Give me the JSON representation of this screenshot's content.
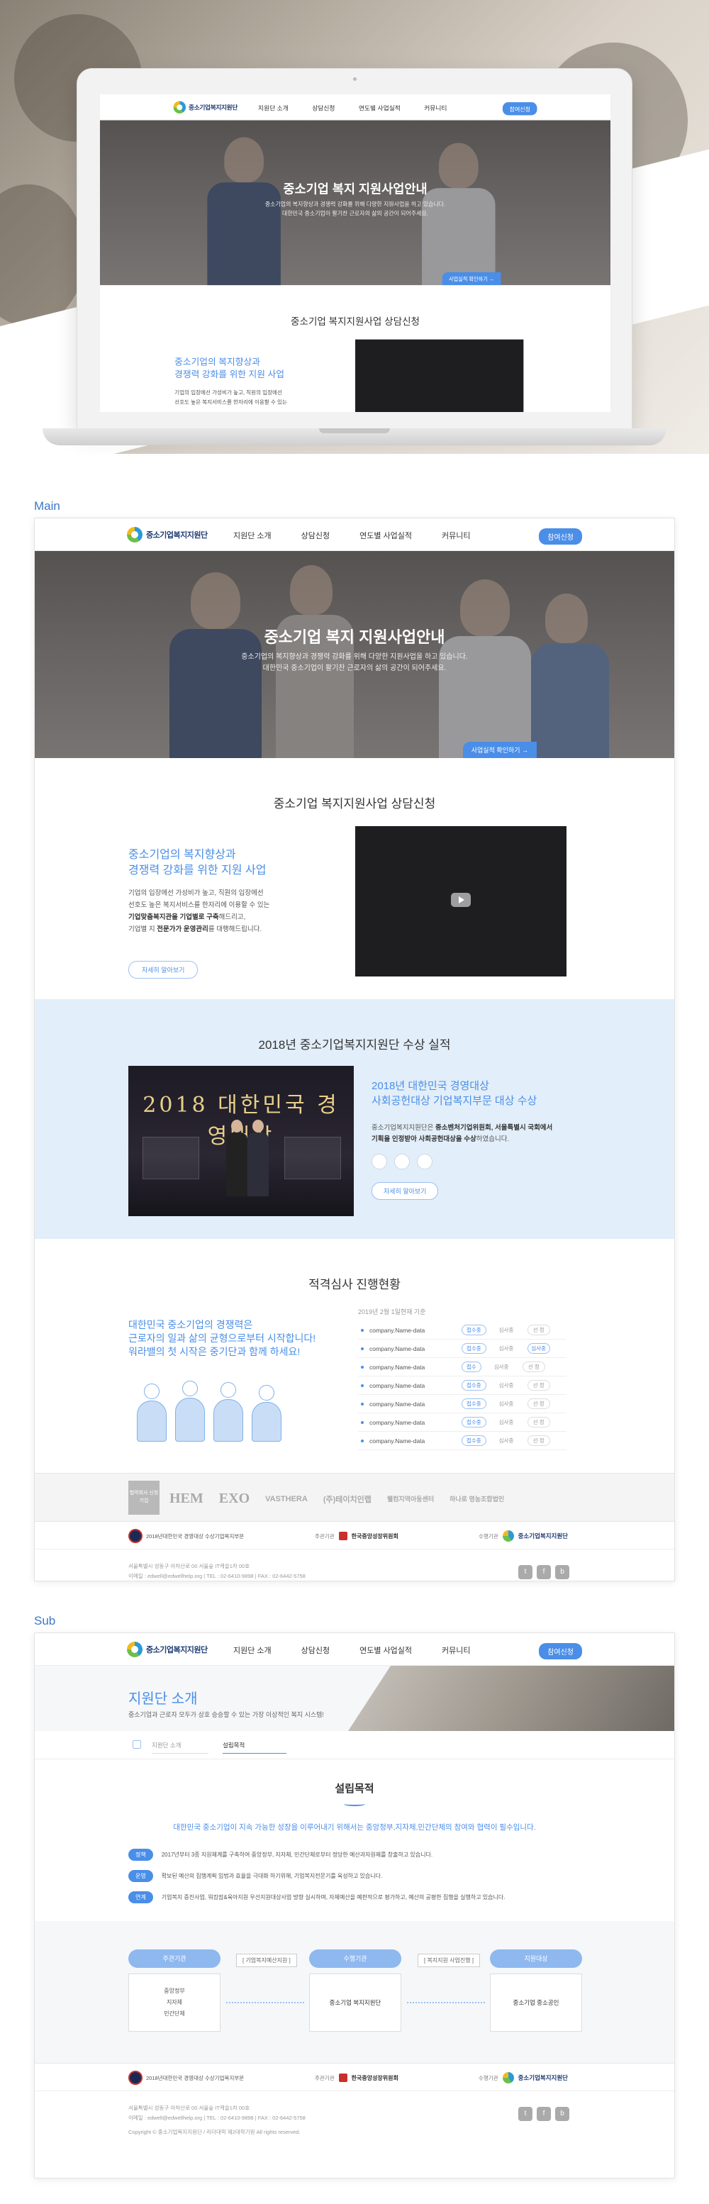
{
  "site": {
    "logo_text": "중소기업복지지원단",
    "nav": [
      "지원단 소개",
      "상담신청",
      "연도별 사업실적",
      "커뮤니티"
    ],
    "login_label": "참여신청"
  },
  "sections": {
    "main_label": "Main",
    "sub_label": "Sub"
  },
  "hero": {
    "title": "중소기업 복지 지원사업안내",
    "desc_line1": "중소기업의 복지향상과 경쟁력 강화를 위해 다양한 지원사업을 하고 있습니다.",
    "desc_line2": "대한민국 중소기업이 활기찬 근로자의 삶의 공간이 되어주세요.",
    "more_label": "사업실적 확인하기 →"
  },
  "consult": {
    "title": "중소기업 복지지원사업 상담신청",
    "sub_line1": "중소기업의 복지향상과",
    "sub_line2": "경쟁력 강화를 위한 지원 사업",
    "text_line1": "기업의 입장에선 가성비가 높고, 직원의 입장에선",
    "text_line2": "선호도 높은 복지서비스를 한자리에 이용할 수 있는",
    "text_bold3": "기업맞춤복지관을 기업별로 구축",
    "text_line3_rest": "해드리고,",
    "text_line4_pre": "기업별 지 ",
    "text_bold4": "전문가가 운영관리",
    "text_line4_rest": "를 대행해드립니다.",
    "more_label": "자세히 알아보기"
  },
  "award": {
    "title": "2018년 중소기업복지지원단 수상 실적",
    "banner_text": "2018 대한민국 경영대상",
    "sub_line1": "2018년 대한민국 경영대상",
    "sub_line2": "사회공헌대상 기업복지부문 대상 수상",
    "text_line1_pre": "중소기업복지지원단은 ",
    "text_bold1": "중소벤처기업위원회, 서울특별시 국회에서",
    "text_bold2": "기획을 인정받아 사회공헌대상을 수상",
    "text_line2_rest": "하였습니다.",
    "more_label": "자세히 알아보기"
  },
  "review": {
    "title": "적격심사 진행현황",
    "slogan_line1": "대한민국 중소기업의 경쟁력은",
    "slogan_line2": "근로자의 일과 삶의 균형으로부터 시작합니다!",
    "slogan_line3": "워라밸의 첫 시작은 중기단과 함께 하세요!",
    "date": "2019년 2월 1일현재 기준",
    "rows": [
      {
        "name": "company.Name-data",
        "tag": "접수중",
        "s1": "심사중",
        "s2": "선 정",
        "on": false
      },
      {
        "name": "company.Name-data",
        "tag": "접수중",
        "s1": "심사중",
        "s2": "심사중",
        "on": true
      },
      {
        "name": "company.Name-data",
        "tag": "접수",
        "s1": "심사중",
        "s2": "선 정",
        "on": false
      },
      {
        "name": "company.Name-data",
        "tag": "접수중",
        "s1": "심사중",
        "s2": "선 정",
        "on": false
      },
      {
        "name": "company.Name-data",
        "tag": "접수중",
        "s1": "심사중",
        "s2": "선 정",
        "on": false
      },
      {
        "name": "company.Name-data",
        "tag": "접수중",
        "s1": "심사중",
        "s2": "선 정",
        "on": false
      },
      {
        "name": "company.Name-data",
        "tag": "접수중",
        "s1": "심사중",
        "s2": "선 정",
        "on": false
      }
    ]
  },
  "partners": {
    "first": "협약회사 신청기업",
    "items": [
      "HEM",
      "EXO",
      "VASTHERA",
      "(주)테이치인랩",
      "웰컴지역아동센터",
      "하나로 영농조합법인"
    ]
  },
  "footer": {
    "emblem_text": "2018년대한민국 경영대상 수상기업복지부문",
    "host_label": "주관기관",
    "host_name": "한국중앙성장위원회",
    "run_label": "수행기관",
    "run_name": "중소기업복지지원단",
    "info_line1": "서울특별시 성동구 아차산로 00 서울숲 IT캐슬1차 00호",
    "info_line2": "이메일 : edwell@edwellhelp.org  |  TEL : 02-6410-9898  |  FAX : 02-6442-5758",
    "info_line3": "Copyright © 중소기업복지지원단 / 리더대학 제2대학기원 All rights reserved.",
    "sns": [
      "t",
      "f",
      "b"
    ]
  },
  "sub": {
    "title": "지원단 소개",
    "desc": "중소기업과 근로자 모두가 상호 승승할 수 있는 가장 이상적인 복지 시스템!",
    "crumb1": "지원단 소개",
    "crumb2": "설립목적",
    "purpose_title": "설립목적",
    "purpose_lead": "대한민국 중소기업이 지속 가능한 성장을 이루어내기 위해서는 중앙정부,지자체,민간단체의 참여와 협력이 필수입니다.",
    "purpose_rows": [
      {
        "pill": "정책",
        "text": "2017년부터 3종 지원체계를 구축하여 중앙정부, 지자체, 민간단체로부터 정당한 예산과자원제를 창출하고 있습니다."
      },
      {
        "pill": "운영",
        "text": "확보된 예산의 집행계획 입법과 효율을 극대화 하기위해, 기업복지전문기를 육성하고 있습니다."
      },
      {
        "pill": "연계",
        "text": "기업복지 증진사업, 워킹맘&육아지원 우선지원대상사업 방향 실시하며, 자체예산을 예판적으로 평가하고, 예산의 공평한 집행을 실행하고 있습니다."
      }
    ],
    "flow": {
      "head1": "주관기관",
      "mid1": "[ 기업복지예산지원 ]",
      "head2": "수행기관",
      "mid2": "[ 복지지원 사업진행 ]",
      "head3": "지원대상",
      "box1_lines": [
        "중앙정부",
        "지자체",
        "민간단체"
      ],
      "box2": "중소기업 복지지원단",
      "box3": "중소기업 중소공인"
    }
  }
}
